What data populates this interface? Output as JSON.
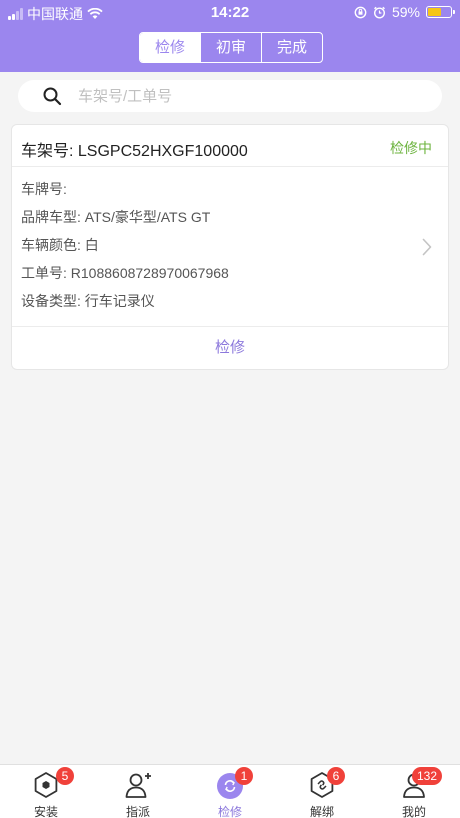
{
  "status_bar": {
    "carrier": "中国联通",
    "time": "14:22",
    "battery_percent": "59%",
    "battery_level": 0.59
  },
  "header": {
    "tabs": [
      {
        "label": "检修",
        "active": true
      },
      {
        "label": "初审",
        "active": false
      },
      {
        "label": "完成",
        "active": false
      }
    ]
  },
  "search": {
    "placeholder": "车架号/工单号",
    "value": ""
  },
  "record": {
    "vin_label": "车架号:",
    "vin": "LSGPC52HXGF100000",
    "status": "检修中",
    "fields": [
      {
        "label": "车牌号:",
        "value": ""
      },
      {
        "label": "品牌车型:",
        "value": "ATS/豪华型/ATS GT"
      },
      {
        "label": "车辆颜色:",
        "value": "白"
      },
      {
        "label": "工单号:",
        "value": "R1088608728970067968"
      },
      {
        "label": "设备类型:",
        "value": "行车记录仪"
      }
    ],
    "action_label": "检修"
  },
  "tabbar": {
    "items": [
      {
        "label": "安装",
        "badge": "5",
        "icon": "hexagon-dot-icon"
      },
      {
        "label": "指派",
        "badge": "",
        "icon": "user-add-icon"
      },
      {
        "label": "检修",
        "badge": "1",
        "icon": "repair-icon",
        "active": true
      },
      {
        "label": "解绑",
        "badge": "6",
        "icon": "unlink-hexagon-icon"
      },
      {
        "label": "我的",
        "badge": "132",
        "icon": "user-icon"
      }
    ]
  },
  "colors": {
    "accent": "#9b86ee",
    "status_green": "#6cb33e",
    "badge_red": "#f0413a",
    "battery_yellow": "#f5c518"
  }
}
